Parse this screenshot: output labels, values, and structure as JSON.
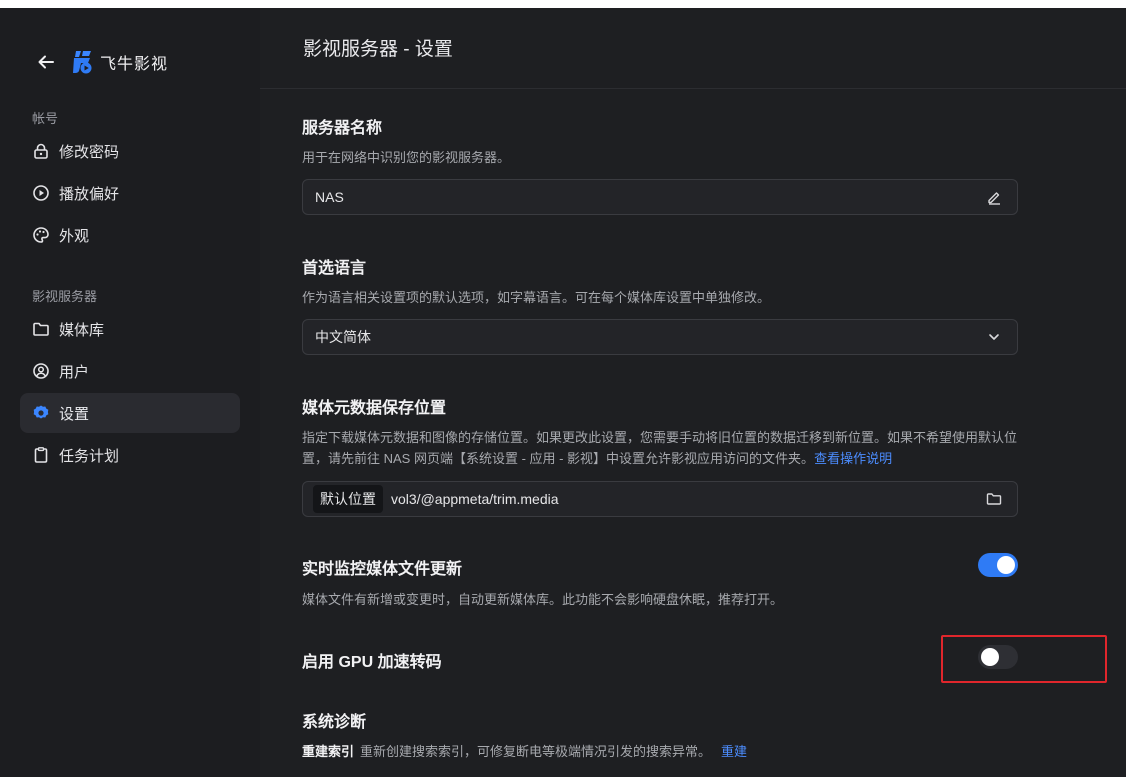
{
  "app": {
    "name": "飞牛影视"
  },
  "sidebar": {
    "account_label": "帐号",
    "server_label": "影视服务器",
    "items": [
      {
        "label": "修改密码",
        "icon": "lock-icon"
      },
      {
        "label": "播放偏好",
        "icon": "play-circle-icon"
      },
      {
        "label": "外观",
        "icon": "palette-icon"
      },
      {
        "label": "媒体库",
        "icon": "folder-icon"
      },
      {
        "label": "用户",
        "icon": "user-circle-icon"
      },
      {
        "label": "设置",
        "icon": "gear-icon",
        "active": true
      },
      {
        "label": "任务计划",
        "icon": "clipboard-icon"
      }
    ]
  },
  "header": {
    "title": "影视服务器 - 设置"
  },
  "settings": {
    "server_name": {
      "title": "服务器名称",
      "desc": "用于在网络中识别您的影视服务器。",
      "value": "NAS"
    },
    "language": {
      "title": "首选语言",
      "desc": "作为语言相关设置项的默认选项，如字幕语言。可在每个媒体库设置中单独修改。",
      "value": "中文简体"
    },
    "metadata_location": {
      "title": "媒体元数据保存位置",
      "desc": "指定下载媒体元数据和图像的存储位置。如果更改此设置，您需要手动将旧位置的数据迁移到新位置。如果不希望使用默认位置，请先前往 NAS 网页端【系统设置 - 应用 - 影视】中设置允许影视应用访问的文件夹。",
      "link": "查看操作说明",
      "tag": "默认位置",
      "value": "vol3/@appmeta/trim.media"
    },
    "realtime_monitor": {
      "title": "实时监控媒体文件更新",
      "desc": "媒体文件有新增或变更时，自动更新媒体库。此功能不会影响硬盘休眠，推荐打开。",
      "enabled": true
    },
    "gpu": {
      "title": "启用 GPU 加速转码",
      "enabled": false
    },
    "diagnostics": {
      "title": "系统诊断",
      "reindex_label": "重建索引",
      "reindex_desc": "重新创建搜索索引，可修复断电等极端情况引发的搜索异常。",
      "reindex_link": "重建"
    }
  },
  "colors": {
    "accent": "#2f7bf5",
    "link": "#4c8dff",
    "highlight": "#e0262c"
  }
}
